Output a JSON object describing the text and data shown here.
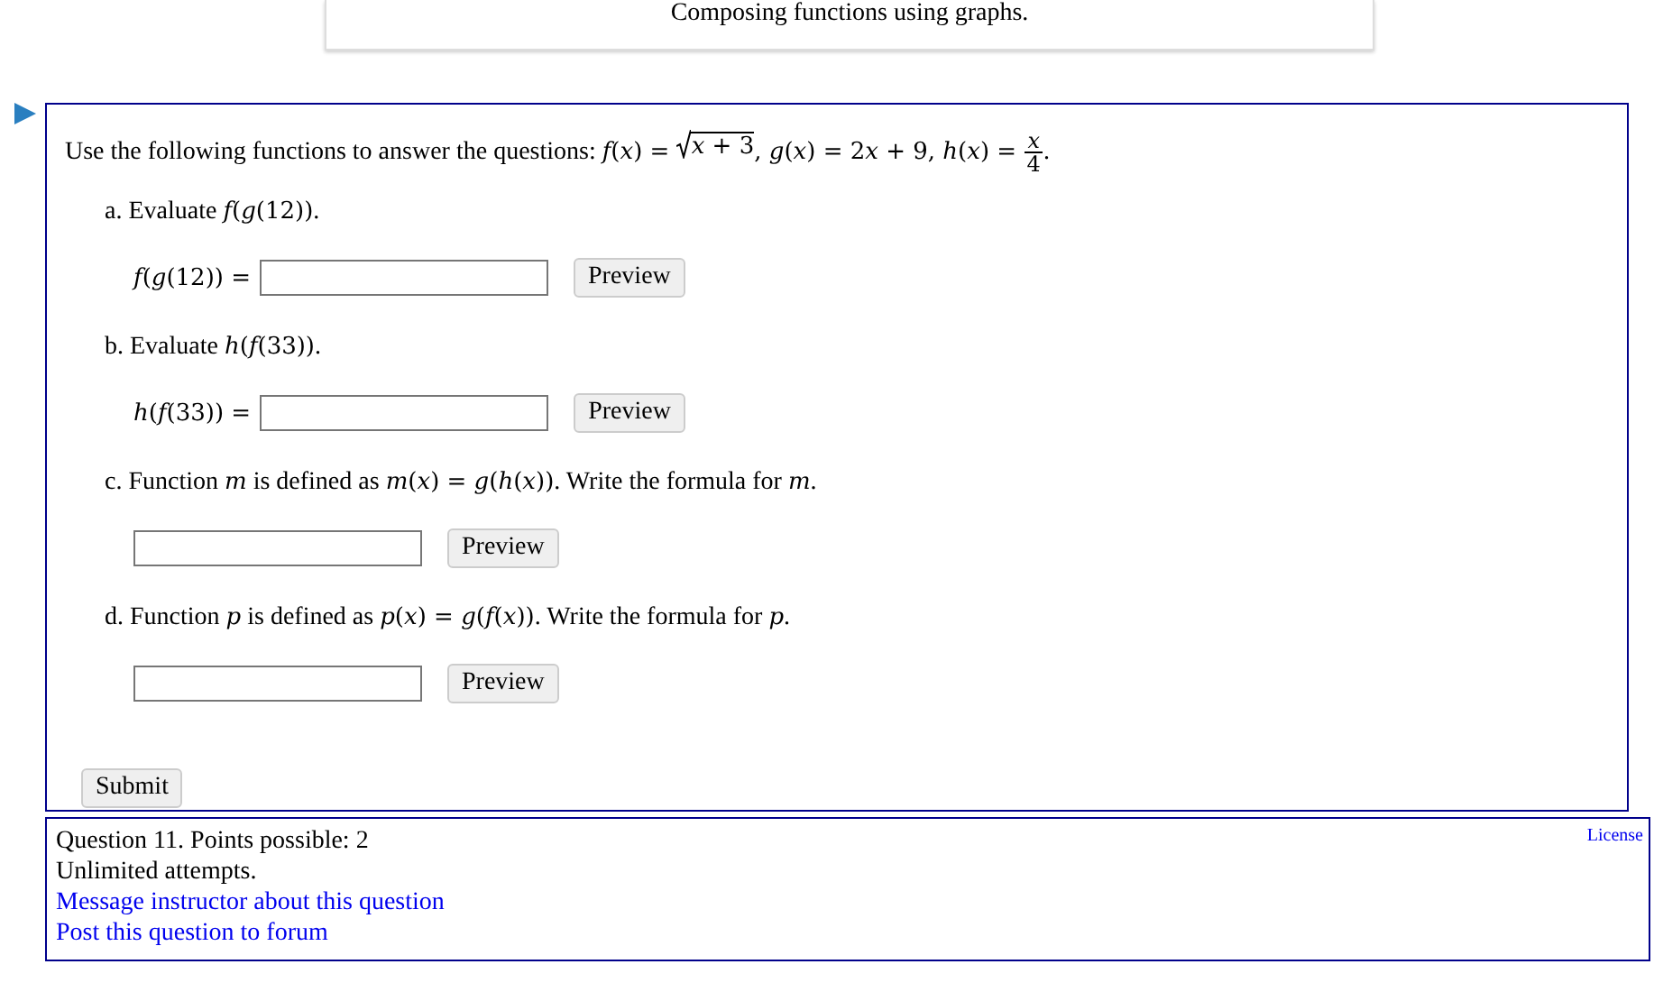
{
  "header": {
    "title": "Composing functions using graphs."
  },
  "question": {
    "expanded": true,
    "intro": [
      {
        "kind": "text",
        "text": "Use the following functions to answer the questions: "
      },
      {
        "kind": "math",
        "text": "*f*(*x*) = "
      },
      {
        "kind": "sqrt",
        "text": "*x* + 3"
      },
      {
        "kind": "math",
        "text": ", *g*(*x*) = 2"
      },
      {
        "kind": "math",
        "text": "*x* + 9, *h*(*x*) = "
      },
      {
        "kind": "frac",
        "num": "*x*",
        "den": "4"
      },
      {
        "kind": "text",
        "text": "."
      }
    ],
    "parts": [
      {
        "prompt": [
          {
            "kind": "text",
            "text": "a. Evaluate "
          },
          {
            "kind": "math",
            "text": "*f*(*g*(12))"
          },
          {
            "kind": "text",
            "text": "."
          }
        ],
        "answer_label": "*f*(*g*(12)) =",
        "button": "Preview"
      },
      {
        "prompt": [
          {
            "kind": "text",
            "text": "b. Evaluate "
          },
          {
            "kind": "math",
            "text": "*h*(*f*(33))"
          },
          {
            "kind": "text",
            "text": "."
          }
        ],
        "answer_label": "*h*(*f*(33)) =",
        "button": "Preview"
      },
      {
        "prompt": [
          {
            "kind": "text",
            "text": "c. Function "
          },
          {
            "kind": "math",
            "text": "*m*"
          },
          {
            "kind": "text",
            "text": " is defined as "
          },
          {
            "kind": "math",
            "text": "*m*(*x*) = *g*(*h*(*x*))"
          },
          {
            "kind": "text",
            "text": ". Write the formula for "
          },
          {
            "kind": "math",
            "text": "*m*"
          },
          {
            "kind": "text",
            "text": "."
          }
        ],
        "button": "Preview"
      },
      {
        "prompt": [
          {
            "kind": "text",
            "text": "d. Function "
          },
          {
            "kind": "math",
            "text": "*p*"
          },
          {
            "kind": "text",
            "text": " is defined as "
          },
          {
            "kind": "math",
            "text": "*p*(*x*) = *g*(*f*(*x*))"
          },
          {
            "kind": "text",
            "text": ". Write the formula for "
          },
          {
            "kind": "math",
            "text": "*p*"
          },
          {
            "kind": "text",
            "text": "."
          }
        ],
        "button": "Preview"
      }
    ],
    "submit": "Submit"
  },
  "footer": {
    "info": [
      "Question 11. Points possible: 2",
      "Unlimited attempts."
    ],
    "links": [
      "Message instructor about this question",
      "Post this question to forum"
    ],
    "license": "License"
  }
}
